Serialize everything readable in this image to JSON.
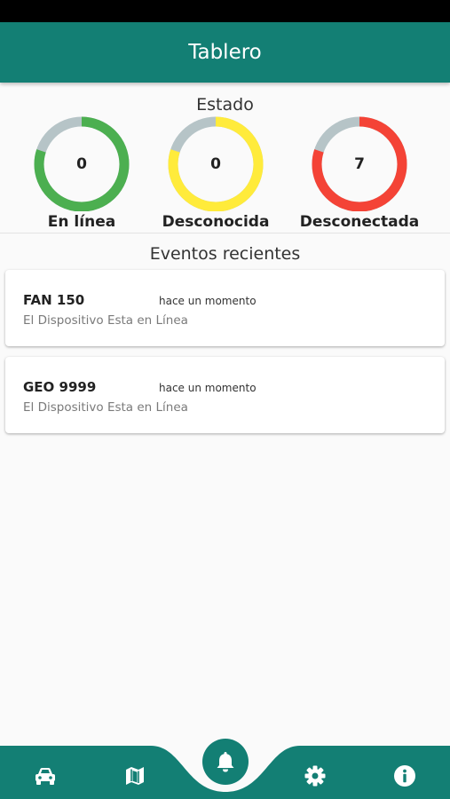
{
  "app_bar": {
    "title": "Tablero"
  },
  "status_section": {
    "title": "Estado",
    "gauges": [
      {
        "label": "En línea",
        "value": "0",
        "color": "#4caf50",
        "fill_fraction": 0.8
      },
      {
        "label": "Desconocida",
        "value": "0",
        "color": "#ffeb3b",
        "fill_fraction": 0.8
      },
      {
        "label": "Desconectada",
        "value": "7",
        "color": "#f44336",
        "fill_fraction": 0.8
      }
    ],
    "track_color": "#b6c4c7"
  },
  "events_section": {
    "title": "Eventos recientes",
    "events": [
      {
        "name": "FAN 150",
        "time": "hace un momento",
        "description": "El Dispositivo Esta en Línea"
      },
      {
        "name": "GEO 9999",
        "time": "hace un momento",
        "description": "El Dispositivo Esta en Línea"
      }
    ]
  },
  "bottom_nav": {
    "accent_color": "#137f74",
    "items": [
      {
        "icon": "car-icon"
      },
      {
        "icon": "map-icon"
      },
      {
        "icon": "bell-icon",
        "active": true
      },
      {
        "icon": "gear-icon"
      },
      {
        "icon": "info-icon"
      }
    ]
  }
}
